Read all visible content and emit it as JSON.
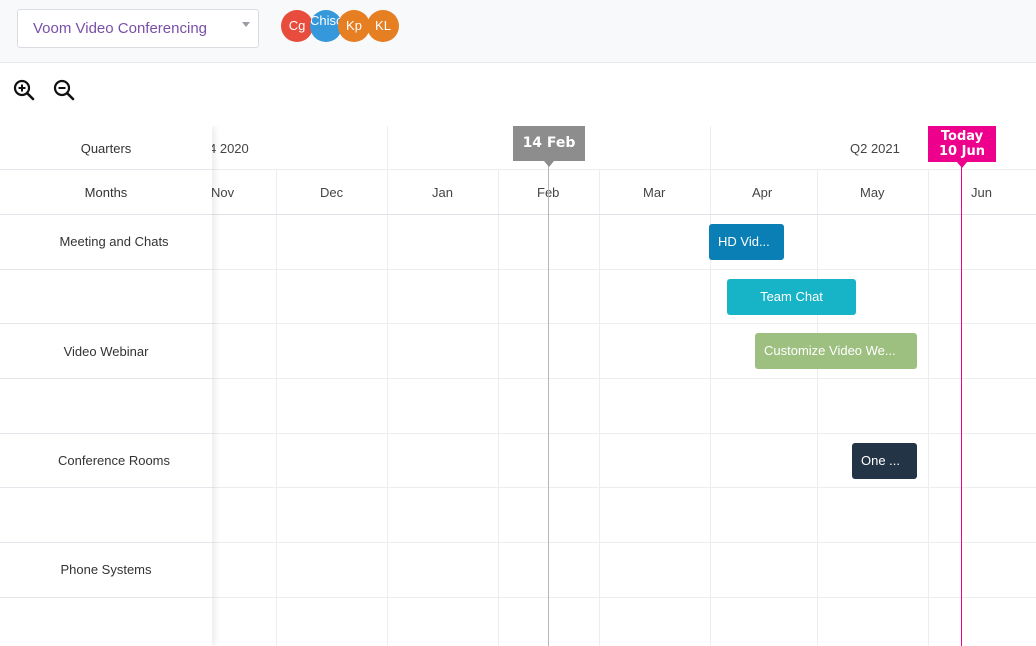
{
  "header": {
    "project_selector": {
      "value": "Voom Video Conferencing"
    },
    "avatars": [
      {
        "initials": "Cg",
        "color": "#e74c3c"
      },
      {
        "initials": "Chisc Test",
        "color": "#3498db"
      },
      {
        "initials": "Kp",
        "color": "#e67e22"
      },
      {
        "initials": "KL",
        "color": "#e67e22"
      }
    ]
  },
  "toolbar": {
    "zoom_in_icon": "zoom-in-icon",
    "zoom_out_icon": "zoom-out-icon"
  },
  "timeline": {
    "row_labels": {
      "quarters": "Quarters",
      "months": "Months"
    },
    "quarters": [
      "4 2020",
      "Q2 2021"
    ],
    "months": [
      "Nov",
      "Dec",
      "Jan",
      "Feb",
      "Mar",
      "Apr",
      "May",
      "Jun"
    ],
    "current_marker": {
      "label": "14 Feb",
      "color": "#8d8d8d"
    },
    "today_marker": {
      "line1": "Today",
      "line2": "10 Jun",
      "color": "#ec008c"
    }
  },
  "groups": [
    {
      "label": "Meeting and Chats"
    },
    {
      "label": "Video Webinar"
    },
    {
      "label": "Conference Rooms"
    },
    {
      "label": "Phone Systems"
    }
  ],
  "tasks": [
    {
      "label": "HD Video Meetings",
      "display": "HD Vid...",
      "color": "#0a7fb5"
    },
    {
      "label": "Team Chat",
      "display": "Team Chat",
      "color": "#17b3c7"
    },
    {
      "label": "Customize Video Webinar",
      "display": "Customize Video We...",
      "color": "#9dbf7f"
    },
    {
      "label": "One Touch",
      "display": "One ...",
      "color": "#243447"
    }
  ]
}
